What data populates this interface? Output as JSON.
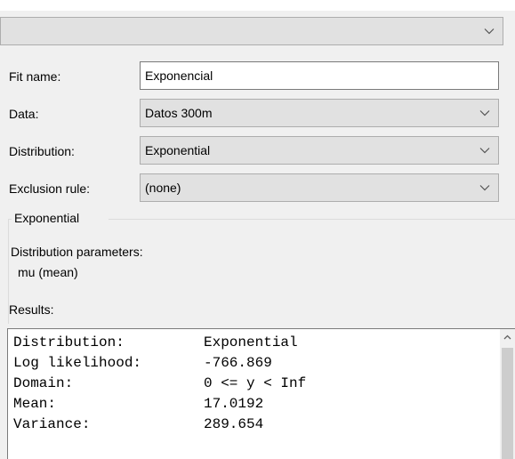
{
  "top_combo": {
    "value": ""
  },
  "fields": {
    "fit_name": {
      "label": "Fit name:",
      "value": "Exponencial"
    },
    "data": {
      "label": "Data:",
      "value": "Datos 300m"
    },
    "distribution": {
      "label": "Distribution:",
      "value": "Exponential"
    },
    "exclusion_rule": {
      "label": "Exclusion rule:",
      "value": "(none)"
    }
  },
  "group": {
    "title": "Exponential",
    "params_label": "Distribution parameters:",
    "params": [
      "mu (mean)"
    ]
  },
  "results": {
    "label": "Results:",
    "rows": [
      {
        "key": "Distribution:",
        "value": "Exponential"
      },
      {
        "key": "Log likelihood:",
        "value": "-766.869"
      },
      {
        "key": "Domain:",
        "value": "0 <= y < Inf"
      },
      {
        "key": "Mean:",
        "value": "17.0192"
      },
      {
        "key": "Variance:",
        "value": "289.654"
      }
    ]
  },
  "icons": {
    "dropdown": "chevron-down-icon",
    "scroll_up": "triangle-up-icon"
  },
  "colors": {
    "window_bg": "#f0f0f0",
    "combo_bg": "#e1e1e1",
    "combo_border": "#adadad",
    "input_border": "#7a7a7a",
    "scroll_thumb": "#cdcdcd"
  }
}
